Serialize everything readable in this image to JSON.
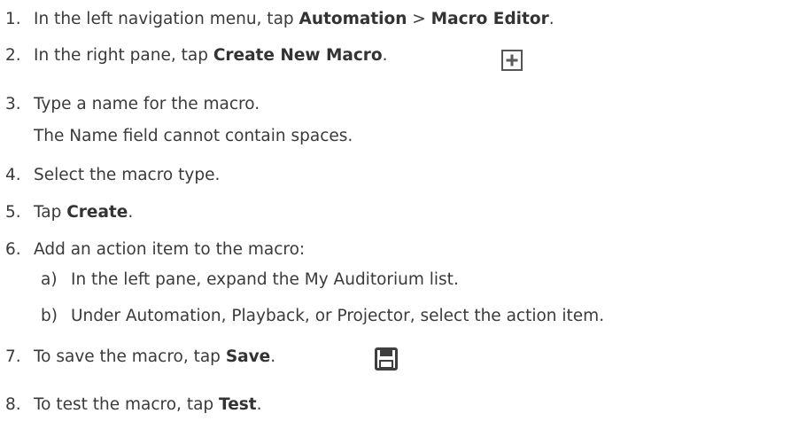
{
  "steps": [
    {
      "num": "1.",
      "pre": "In the left navigation menu, tap ",
      "b1": "Automation",
      "mid": " > ",
      "b2": "Macro Editor",
      "post": "."
    },
    {
      "num": "2.",
      "pre": "In the right pane, tap ",
      "b1": "Create New Macro",
      "post": ".",
      "icon": "plus-box-icon"
    },
    {
      "num": "3.",
      "line1": "Type a name for the macro.",
      "line2": "The Name field cannot contain spaces."
    },
    {
      "num": "4.",
      "text": "Select the macro type."
    },
    {
      "num": "5.",
      "pre": "Tap ",
      "b1": "Create",
      "post": "."
    },
    {
      "num": "6.",
      "text": "Add an action item to the macro:",
      "substeps": [
        {
          "letter": "a)",
          "text": "In the left pane, expand the My Auditorium list."
        },
        {
          "letter": "b)",
          "text": "Under Automation, Playback, or Projector, select the action item."
        }
      ]
    },
    {
      "num": "7.",
      "pre": "To save the macro, tap ",
      "b1": "Save",
      "post": ".",
      "icon": "save-icon"
    },
    {
      "num": "8.",
      "pre": "To test the macro, tap ",
      "b1": "Test",
      "post": "."
    }
  ]
}
